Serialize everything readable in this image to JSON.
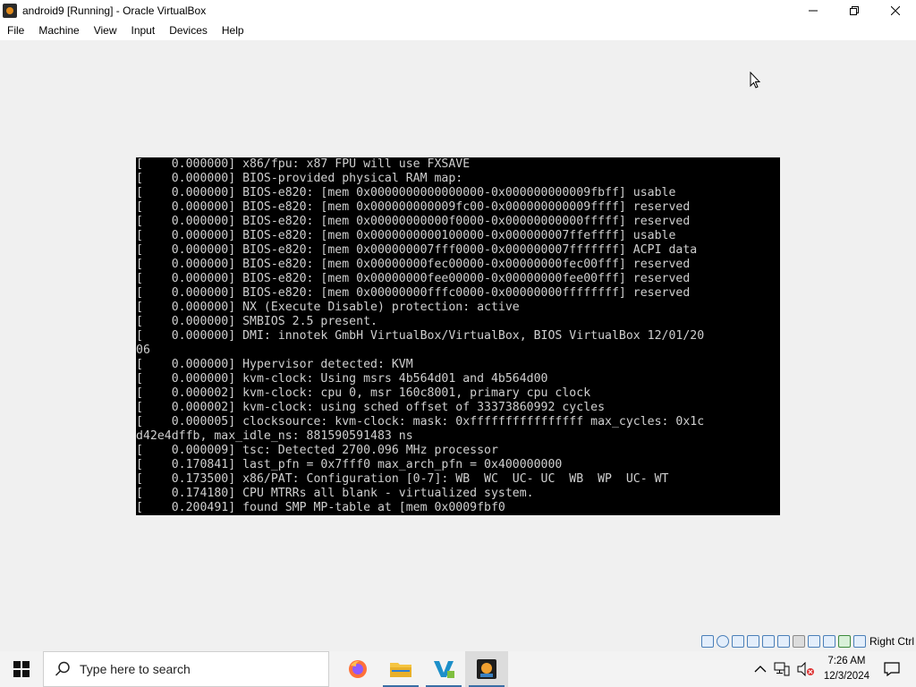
{
  "window": {
    "title": "android9 [Running] - Oracle VirtualBox",
    "controls": [
      "minimize",
      "maximize",
      "close"
    ]
  },
  "menu": {
    "items": [
      "File",
      "Machine",
      "View",
      "Input",
      "Devices",
      "Help"
    ]
  },
  "console": {
    "lines": [
      "[    0.000000] x86/fpu: x87 FPU will use FXSAVE",
      "[    0.000000] BIOS-provided physical RAM map:",
      "[    0.000000] BIOS-e820: [mem 0x0000000000000000-0x000000000009fbff] usable",
      "[    0.000000] BIOS-e820: [mem 0x000000000009fc00-0x000000000009ffff] reserved",
      "[    0.000000] BIOS-e820: [mem 0x00000000000f0000-0x00000000000fffff] reserved",
      "[    0.000000] BIOS-e820: [mem 0x0000000000100000-0x000000007ffeffff] usable",
      "[    0.000000] BIOS-e820: [mem 0x000000007fff0000-0x000000007fffffff] ACPI data",
      "[    0.000000] BIOS-e820: [mem 0x00000000fec00000-0x00000000fec00fff] reserved",
      "[    0.000000] BIOS-e820: [mem 0x00000000fee00000-0x00000000fee00fff] reserved",
      "[    0.000000] BIOS-e820: [mem 0x00000000fffc0000-0x00000000ffffffff] reserved",
      "[    0.000000] NX (Execute Disable) protection: active",
      "[    0.000000] SMBIOS 2.5 present.",
      "[    0.000000] DMI: innotek GmbH VirtualBox/VirtualBox, BIOS VirtualBox 12/01/20",
      "06",
      "[    0.000000] Hypervisor detected: KVM",
      "[    0.000000] kvm-clock: Using msrs 4b564d01 and 4b564d00",
      "[    0.000002] kvm-clock: cpu 0, msr 160c8001, primary cpu clock",
      "[    0.000002] kvm-clock: using sched offset of 33373860992 cycles",
      "[    0.000005] clocksource: kvm-clock: mask: 0xffffffffffffffff max_cycles: 0x1c",
      "d42e4dffb, max_idle_ns: 881590591483 ns",
      "[    0.000009] tsc: Detected 2700.096 MHz processor",
      "[    0.170841] last_pfn = 0x7fff0 max_arch_pfn = 0x400000000",
      "[    0.173500] x86/PAT: Configuration [0-7]: WB  WC  UC- UC  WB  WP  UC- WT",
      "[    0.174180] CPU MTRRs all blank - virtualized system.",
      "[    0.200491] found SMP MP-table at [mem 0x0009fbf0"
    ]
  },
  "statusbar": {
    "host_key_label": "Right Ctrl",
    "icons": [
      "hard-disk-icon",
      "optical-drive-icon",
      "audio-icon",
      "network-icon",
      "usb-icon",
      "shared-folders-icon",
      "display-icon",
      "recording-icon",
      "cpu-icon",
      "mouse-integration-icon",
      "keyboard-icon"
    ]
  },
  "taskbar": {
    "search_placeholder": "Type here to search",
    "apps": [
      "firefox-icon",
      "file-explorer-icon",
      "visual-studio-icon",
      "virtualbox-icon"
    ],
    "clock_time": "7:26 AM",
    "clock_date": "12/3/2024"
  },
  "colors": {
    "console_bg": "#000000",
    "console_text": "#cfcfcf",
    "window_bg": "#f0f0f0",
    "taskbar_bg": "#f3f3f3"
  }
}
